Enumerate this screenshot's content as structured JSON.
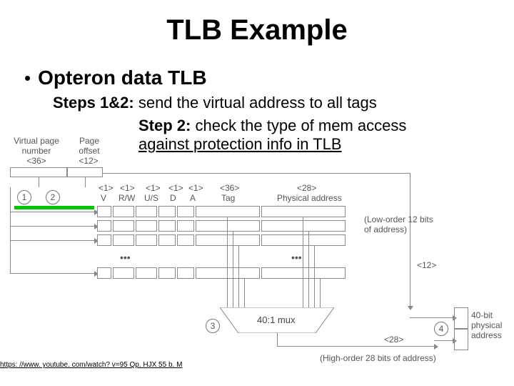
{
  "title": "TLB Example",
  "bullet": "Opteron data TLB",
  "line1_bold": "Steps 1&2:",
  "line1_rest": " send the virtual address to all tags",
  "line2_bold": "Step 2:",
  "line2_rest": " check the type of mem access",
  "line3": "against protection info in TLB",
  "link_text": "https: //www. youtube. com/watch? v=95 Qp. HJX 55 b. M",
  "diagram": {
    "vpn_label": "Virtual page\nnumber",
    "vpn_bits": "<36>",
    "po_label": "Page\noffset",
    "po_bits": "<12>",
    "cols": {
      "v": "V",
      "v_bits": "<1>",
      "rw": "R/W",
      "rw_bits": "<1>",
      "us": "U/S",
      "us_bits": "<1>",
      "d": "D",
      "d_bits": "<1>",
      "a": "A",
      "a_bits": "<1>",
      "tag": "Tag",
      "tag_bits": "<36>",
      "pa": "Physical address",
      "pa_bits": "<28>"
    },
    "mux_label": "40:1 mux",
    "lower_bits": "(Low-order 12 bits\nof address)",
    "lower_angle": "<12>",
    "high_bits": "(High-order 28 bits of address)",
    "high_angle": "<28>",
    "result": "40-bit\nphysical\naddress",
    "step1": "1",
    "step2": "2",
    "step3": "3",
    "step4": "4"
  }
}
